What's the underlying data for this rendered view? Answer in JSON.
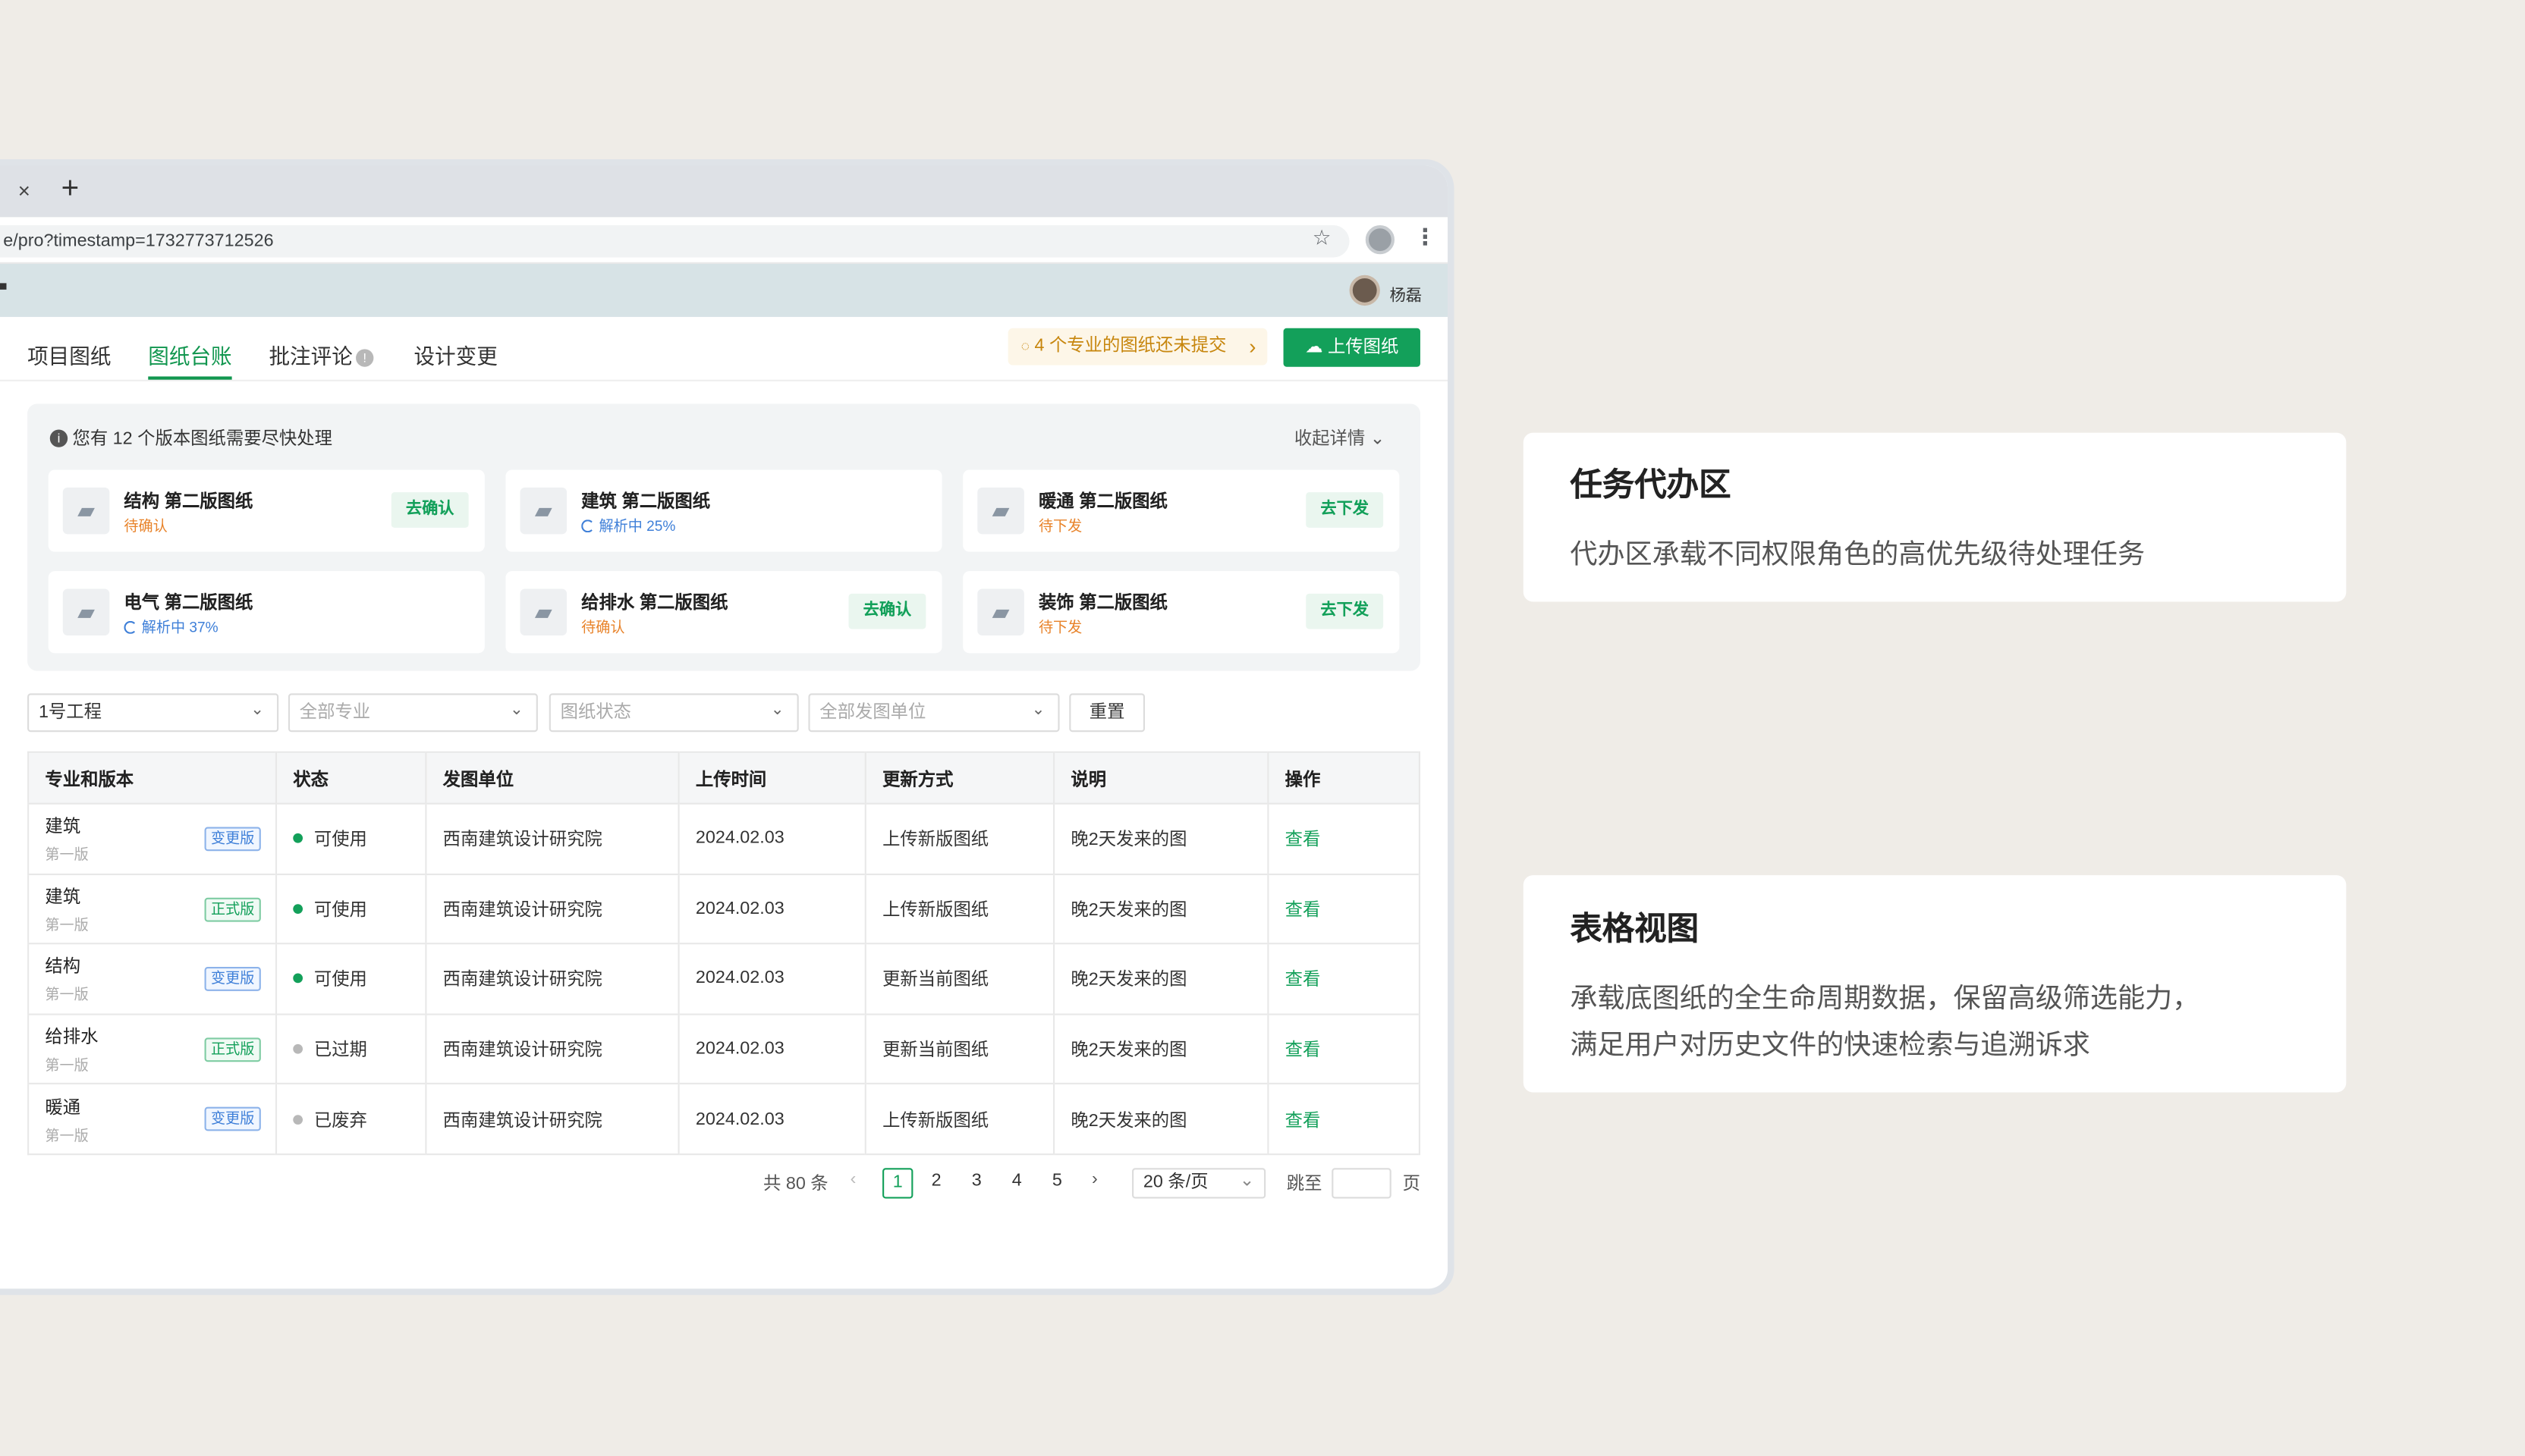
{
  "browser": {
    "tab_close": "×",
    "tab_new": "+",
    "url": "e/pro?timestamp=1732773712526"
  },
  "app": {
    "user_name": "杨磊"
  },
  "nav": {
    "tabs": [
      "项目图纸",
      "图纸台账",
      "批注评论",
      "设计变更"
    ],
    "active_tab": "图纸台账",
    "notice": "4 个专业的图纸还未提交",
    "upload_label": "上传图纸"
  },
  "task_panel": {
    "title": "您有 12 个版本图纸需要尽快处理",
    "collapse_label": "收起详情",
    "cards": [
      {
        "name": "结构 第二版图纸",
        "status": "待确认",
        "action": "去确认"
      },
      {
        "name": "建筑 第二版图纸",
        "status": "解析中 25%",
        "progress": 25,
        "action": ""
      },
      {
        "name": "暖通 第二版图纸",
        "status": "待下发",
        "action": "去下发"
      },
      {
        "name": "电气 第二版图纸",
        "status": "解析中 37%",
        "progress": 37,
        "action": ""
      },
      {
        "name": "给排水 第二版图纸",
        "status": "待确认",
        "action": "去确认"
      },
      {
        "name": "装饰 第二版图纸",
        "status": "待下发",
        "action": "去下发"
      }
    ]
  },
  "filters": {
    "project": "1号工程",
    "discipline_placeholder": "全部专业",
    "status_placeholder": "图纸状态",
    "unit_placeholder": "全部发图单位",
    "reset_label": "重置"
  },
  "table": {
    "headers": [
      "专业和版本",
      "状态",
      "发图单位",
      "上传时间",
      "更新方式",
      "说明",
      "操作"
    ],
    "rows": [
      {
        "discipline": "建筑",
        "version": "第一版",
        "tag": "变更版",
        "status": "可使用",
        "unit": "西南建筑设计研究院",
        "time": "2024.02.03",
        "method": "上传新版图纸",
        "note": "晚2天发来的图",
        "action": "查看"
      },
      {
        "discipline": "建筑",
        "version": "第一版",
        "tag": "正式版",
        "status": "可使用",
        "unit": "西南建筑设计研究院",
        "time": "2024.02.03",
        "method": "上传新版图纸",
        "note": "晚2天发来的图",
        "action": "查看"
      },
      {
        "discipline": "结构",
        "version": "第一版",
        "tag": "变更版",
        "status": "可使用",
        "unit": "西南建筑设计研究院",
        "time": "2024.02.03",
        "method": "更新当前图纸",
        "note": "晚2天发来的图",
        "action": "查看"
      },
      {
        "discipline": "给排水",
        "version": "第一版",
        "tag": "正式版",
        "status": "已过期",
        "unit": "西南建筑设计研究院",
        "time": "2024.02.03",
        "method": "更新当前图纸",
        "note": "晚2天发来的图",
        "action": "查看"
      },
      {
        "discipline": "暖通",
        "version": "第一版",
        "tag": "变更版",
        "status": "已废弃",
        "unit": "西南建筑设计研究院",
        "time": "2024.02.03",
        "method": "上传新版图纸",
        "note": "晚2天发来的图",
        "action": "查看"
      }
    ]
  },
  "pagination": {
    "total": "共 80 条",
    "prev": "‹",
    "next": "›",
    "pages": [
      "1",
      "2",
      "3",
      "4",
      "5"
    ],
    "current": "1",
    "per_page": "20 条/页",
    "jump_label": "跳至",
    "page_suffix": "页"
  },
  "callouts": [
    {
      "title": "任务代办区",
      "body": "代办区承载不同权限角色的高优先级待处理任务"
    },
    {
      "title": "表格视图",
      "body": "承载底图纸的全生命周期数据，保留高级筛选能力，\n满足用户对历史文件的快速检索与追溯诉求"
    }
  ],
  "colors": {
    "accent_green": "#13a05a",
    "warning_orange": "#e8832a",
    "info_blue": "#3e7fd8",
    "notice_bg": "#fdf6e8",
    "page_bg": "#efece7"
  }
}
